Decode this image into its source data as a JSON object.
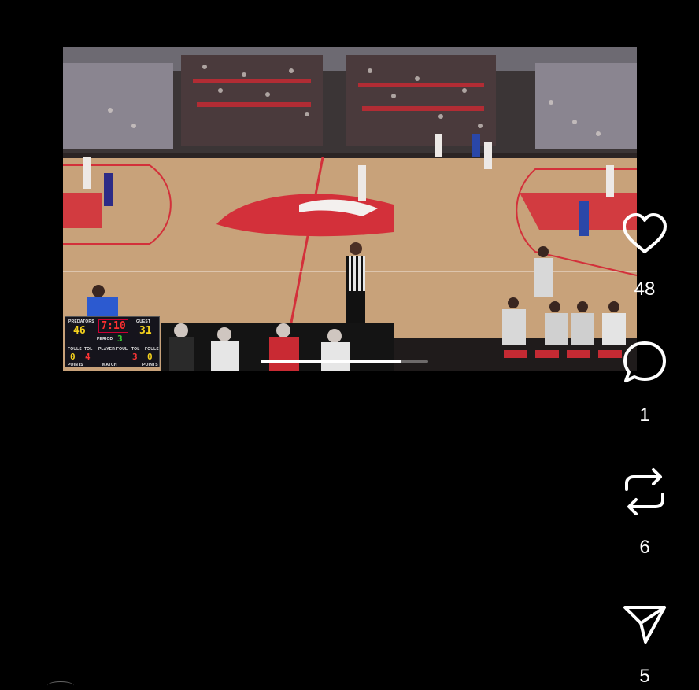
{
  "scoreboard": {
    "home_label": "PREDATORS",
    "home_score": "46",
    "clock": "7:10",
    "guest_label": "GUEST",
    "guest_score": "31",
    "period_label": "PERIOD",
    "period": "3",
    "home_fouls_label": "FOULS",
    "home_tol_label": "TOL",
    "player_foul_label": "PLAYER-FOUL",
    "guest_tol_label": "TOL",
    "guest_fouls_label": "FOULS",
    "home_fouls": "0",
    "home_tol": "4",
    "guest_tol": "3",
    "guest_fouls": "0",
    "points_label_left": "POINTS",
    "match_label": "MATCH",
    "points_label_right": "POINTS"
  },
  "video": {
    "progress": 0.84
  },
  "actions": {
    "likes": "48",
    "comments": "1",
    "reposts": "6",
    "shares": "5"
  },
  "colors": {
    "background": "#000000",
    "court_red": "#d3303a",
    "scoreboard_yellow": "#f5d21c"
  }
}
